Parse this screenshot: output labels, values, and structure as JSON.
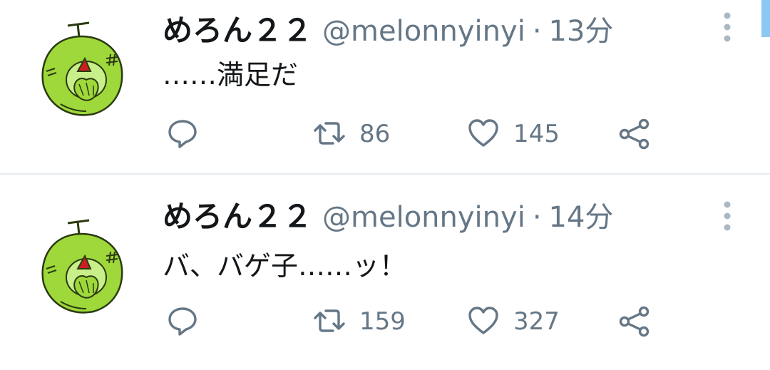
{
  "tweets": [
    {
      "name": "めろん２２",
      "handle": "@melonnyinyi",
      "separator": "·",
      "time": "13分",
      "text": "……満足だ",
      "retweets": "86",
      "likes": "145"
    },
    {
      "name": "めろん２２",
      "handle": "@melonnyinyi",
      "separator": "·",
      "time": "14分",
      "text": "バ、バゲ子……ッ！",
      "retweets": "159",
      "likes": "327"
    }
  ],
  "icons": {
    "reply": "reply-icon",
    "retweet": "retweet-icon",
    "like": "heart-icon",
    "share": "share-icon",
    "more": "more-vertical-icon"
  },
  "colors": {
    "text": "#14171a",
    "secondary": "#657786",
    "divider": "#e6ecf0",
    "scrollbar": "#8cc8f4",
    "avatar_green": "#9ed83a"
  }
}
